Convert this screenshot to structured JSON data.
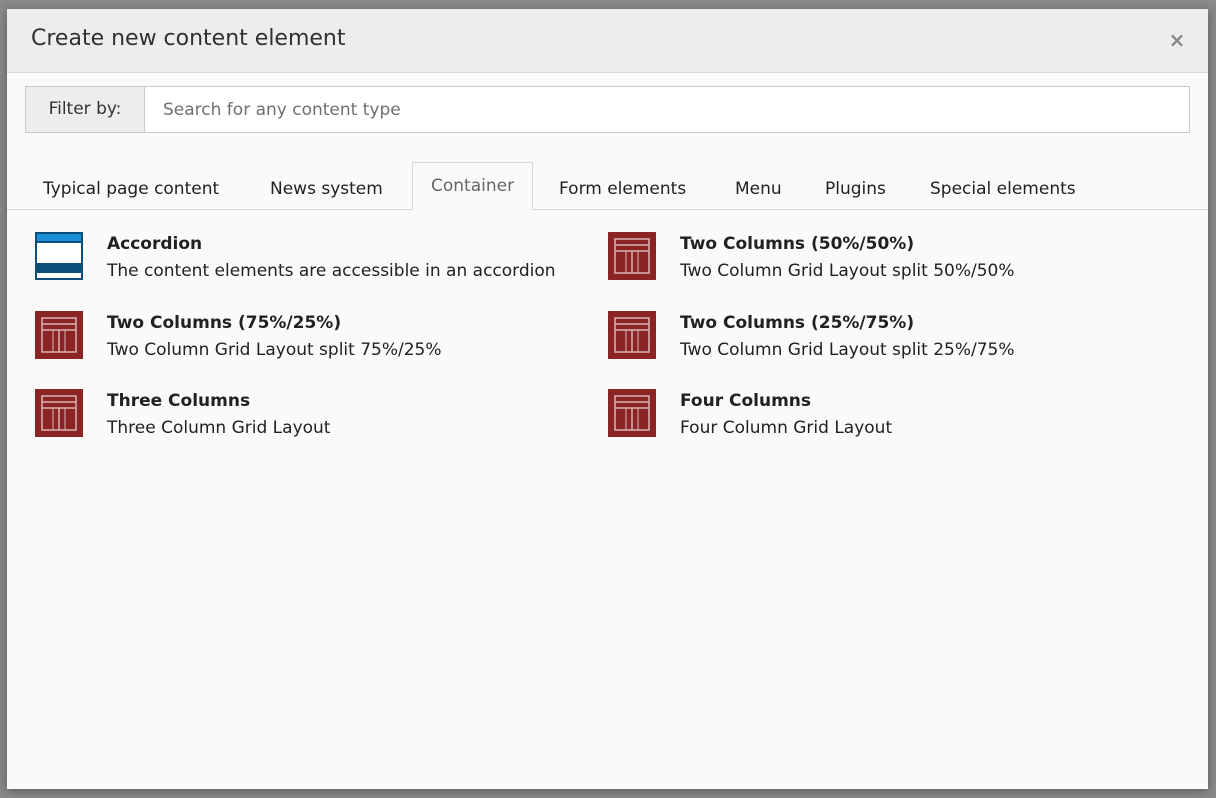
{
  "modal": {
    "title": "Create new content element",
    "close_symbol": "×"
  },
  "filter": {
    "label": "Filter by:",
    "placeholder": "Search for any content type",
    "value": ""
  },
  "tabs": [
    {
      "label": "Typical page content",
      "active": false
    },
    {
      "label": "News system",
      "active": false
    },
    {
      "label": "Container",
      "active": true
    },
    {
      "label": "Form elements",
      "active": false
    },
    {
      "label": "Menu",
      "active": false
    },
    {
      "label": "Plugins",
      "active": false
    },
    {
      "label": "Special elements",
      "active": false
    }
  ],
  "items": [
    {
      "title": "Accordion",
      "description": "The content elements are accessible in an accordion",
      "icon": "accordion-icon"
    },
    {
      "title": "Two Columns (50%/50%)",
      "description": "Two Column Grid Layout split 50%/50%",
      "icon": "grid-layout-icon"
    },
    {
      "title": "Two Columns (75%/25%)",
      "description": "Two Column Grid Layout split 75%/25%",
      "icon": "grid-layout-icon"
    },
    {
      "title": "Two Columns (25%/75%)",
      "description": "Two Column Grid Layout split 25%/75%",
      "icon": "grid-layout-icon"
    },
    {
      "title": "Three Columns",
      "description": "Three Column Grid Layout",
      "icon": "grid-layout-icon"
    },
    {
      "title": "Four Columns",
      "description": "Four Column Grid Layout",
      "icon": "grid-layout-icon"
    }
  ],
  "colors": {
    "grid_icon": "#8b2424",
    "accordion_blue": "#1a8fd8",
    "accordion_dark": "#0b4f7a"
  }
}
